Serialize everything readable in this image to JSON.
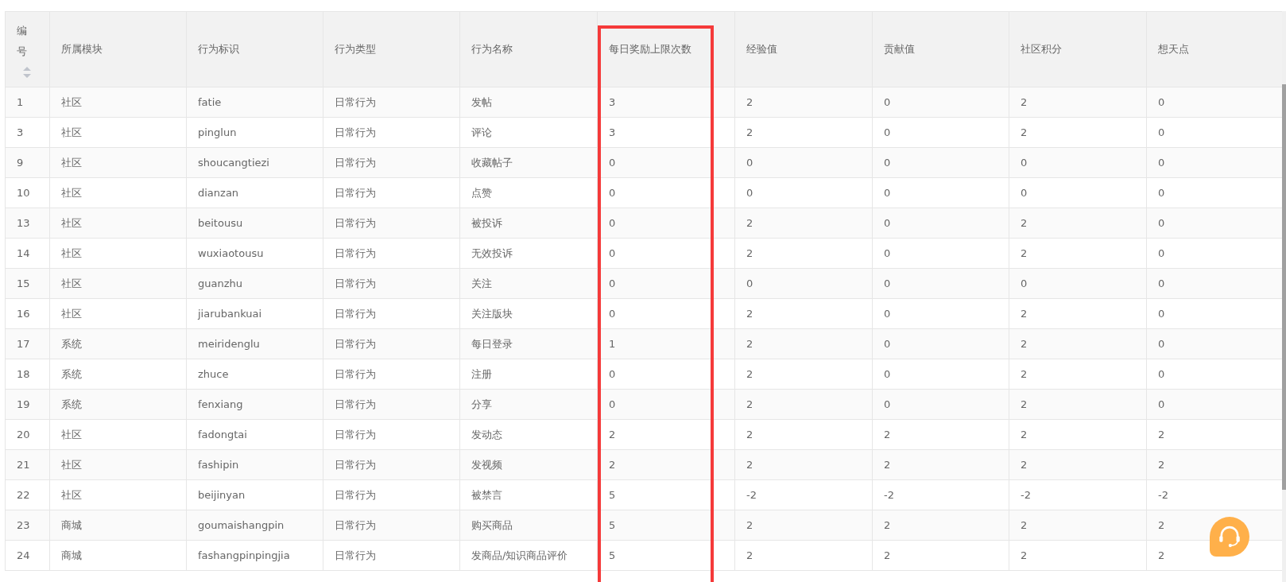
{
  "table": {
    "columns": [
      {
        "label": "编号",
        "sortable": true,
        "highlighted": false
      },
      {
        "label": "所属模块",
        "sortable": false,
        "highlighted": false
      },
      {
        "label": "行为标识",
        "sortable": false,
        "highlighted": false
      },
      {
        "label": "行为类型",
        "sortable": false,
        "highlighted": false
      },
      {
        "label": "行为名称",
        "sortable": false,
        "highlighted": false
      },
      {
        "label": "每日奖励上限次数",
        "sortable": false,
        "highlighted": true
      },
      {
        "label": "经验值",
        "sortable": false,
        "highlighted": false
      },
      {
        "label": "贡献值",
        "sortable": false,
        "highlighted": false
      },
      {
        "label": "社区积分",
        "sortable": false,
        "highlighted": false
      },
      {
        "label": "想天点",
        "sortable": false,
        "highlighted": false
      }
    ],
    "rows": [
      [
        "1",
        "社区",
        "fatie",
        "日常行为",
        "发帖",
        "3",
        "2",
        "0",
        "2",
        "0"
      ],
      [
        "3",
        "社区",
        "pinglun",
        "日常行为",
        "评论",
        "3",
        "2",
        "0",
        "2",
        "0"
      ],
      [
        "9",
        "社区",
        "shoucangtiezi",
        "日常行为",
        "收藏帖子",
        "0",
        "0",
        "0",
        "0",
        "0"
      ],
      [
        "10",
        "社区",
        "dianzan",
        "日常行为",
        "点赞",
        "0",
        "0",
        "0",
        "0",
        "0"
      ],
      [
        "13",
        "社区",
        "beitousu",
        "日常行为",
        "被投诉",
        "0",
        "2",
        "0",
        "2",
        "0"
      ],
      [
        "14",
        "社区",
        "wuxiaotousu",
        "日常行为",
        "无效投诉",
        "0",
        "2",
        "0",
        "2",
        "0"
      ],
      [
        "15",
        "社区",
        "guanzhu",
        "日常行为",
        "关注",
        "0",
        "0",
        "0",
        "0",
        "0"
      ],
      [
        "16",
        "社区",
        "jiarubankuai",
        "日常行为",
        "关注版块",
        "0",
        "2",
        "0",
        "2",
        "0"
      ],
      [
        "17",
        "系统",
        "meiridenglu",
        "日常行为",
        "每日登录",
        "1",
        "2",
        "0",
        "2",
        "0"
      ],
      [
        "18",
        "系统",
        "zhuce",
        "日常行为",
        "注册",
        "0",
        "2",
        "0",
        "2",
        "0"
      ],
      [
        "19",
        "系统",
        "fenxiang",
        "日常行为",
        "分享",
        "0",
        "2",
        "0",
        "2",
        "0"
      ],
      [
        "20",
        "社区",
        "fadongtai",
        "日常行为",
        "发动态",
        "2",
        "2",
        "2",
        "2",
        "2"
      ],
      [
        "21",
        "社区",
        "fashipin",
        "日常行为",
        "发视频",
        "2",
        "2",
        "2",
        "2",
        "2"
      ],
      [
        "22",
        "社区",
        "beijinyan",
        "日常行为",
        "被禁言",
        "5",
        "-2",
        "-2",
        "-2",
        "-2"
      ],
      [
        "23",
        "商城",
        "goumaishangpin",
        "日常行为",
        "购买商品",
        "5",
        "2",
        "2",
        "2",
        "2"
      ],
      [
        "24",
        "商城",
        "fashangpinpingjia",
        "日常行为",
        "发商品/知识商品评价",
        "5",
        "2",
        "2",
        "2",
        "2"
      ]
    ]
  }
}
